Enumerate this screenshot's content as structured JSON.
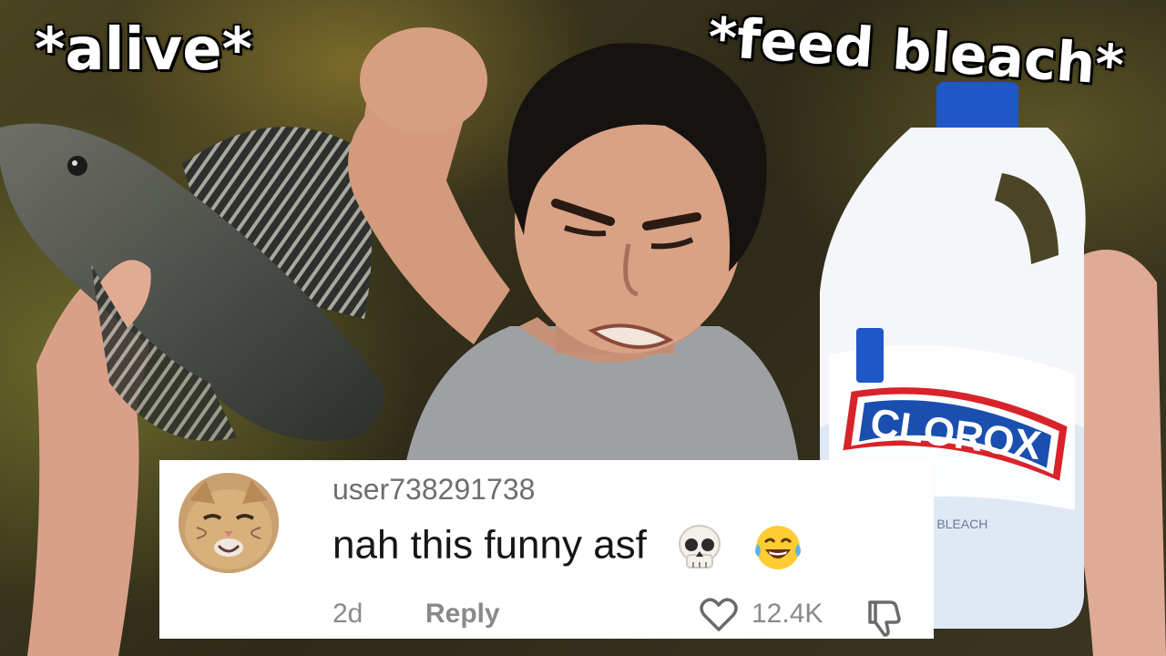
{
  "captions": {
    "left": "*alive*",
    "right": "*feed bleach*"
  },
  "bottle": {
    "brand": "CLOROX",
    "subtext": "ASH BLEACH"
  },
  "comment": {
    "username": "user738291738",
    "text": "nah this funny asf",
    "emojis": [
      "skull-emoji",
      "tears-of-joy-emoji"
    ],
    "age": "2d",
    "reply_label": "Reply",
    "like_count": "12.4K",
    "icons": [
      "heart-icon",
      "dislike-icon"
    ]
  },
  "colors": {
    "caption_text": "#ffffff",
    "card_background": "#ffffff",
    "bottle_brand_blue": "#1a4fb0",
    "bottle_brand_red": "#d8232a"
  }
}
